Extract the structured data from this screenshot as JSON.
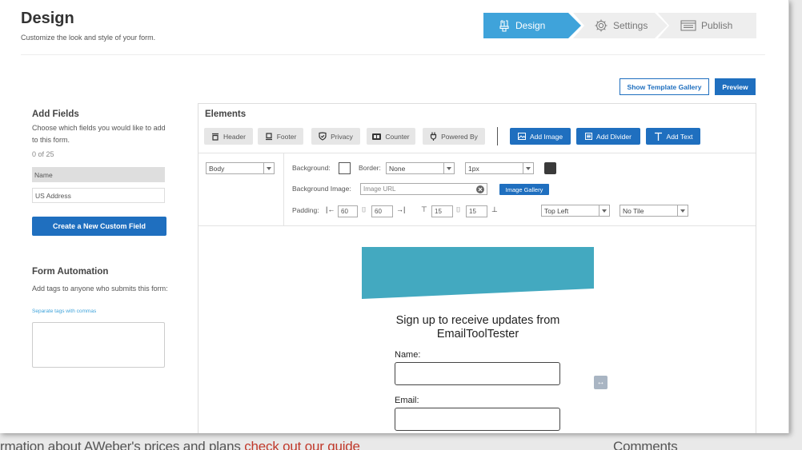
{
  "background_page": {
    "text_left": "rmation about AWeber's prices and plans",
    "text_link": "check out our guide",
    "text_right": "Comments"
  },
  "header": {
    "title": "Design",
    "subtitle": "Customize the look and style of your form.",
    "steps": [
      {
        "label": "Design",
        "icon": "brush-icon",
        "active": true
      },
      {
        "label": "Settings",
        "icon": "gear-icon",
        "active": false
      },
      {
        "label": "Publish",
        "icon": "browser-icon",
        "active": false
      }
    ]
  },
  "actions": {
    "template_gallery": "Show Template Gallery",
    "preview": "Preview"
  },
  "add_fields": {
    "heading": "Add Fields",
    "description": "Choose which fields you would like to add to this form.",
    "count": "0 of 25",
    "fields": [
      "Name",
      "US Address"
    ],
    "create_button": "Create a New Custom Field"
  },
  "automation": {
    "heading": "Form Automation",
    "description": "Add tags to anyone who submits this form:",
    "hint": "Separate tags with commas",
    "tags_value": ""
  },
  "elements": {
    "heading": "Elements",
    "toggles": [
      {
        "label": "Header",
        "icon": "header-icon"
      },
      {
        "label": "Footer",
        "icon": "footer-icon"
      },
      {
        "label": "Privacy",
        "icon": "shield-icon"
      },
      {
        "label": "Counter",
        "icon": "counter-icon"
      },
      {
        "label": "Powered By",
        "icon": "plug-icon"
      }
    ],
    "add_buttons": [
      {
        "label": "Add Image",
        "icon": "image-icon"
      },
      {
        "label": "Add Divider",
        "icon": "divider-icon"
      },
      {
        "label": "Add Text",
        "icon": "text-icon"
      }
    ]
  },
  "toolbar": {
    "section_select": "Body",
    "background_label": "Background:",
    "border_label": "Border:",
    "border_style": "None",
    "border_width": "1px",
    "border_color": "#3a3a3a",
    "background_color": "#ffffff",
    "bg_image_label": "Background Image:",
    "bg_image_placeholder": "Image URL",
    "image_gallery": "Image Gallery",
    "padding_label": "Padding:",
    "padding_left": "60",
    "padding_right": "60",
    "padding_top": "15",
    "padding_bottom": "15",
    "position": "Top Left",
    "tile": "No Tile"
  },
  "form_preview": {
    "banner_color": "#43a9c0",
    "title": "Sign up to receive updates from EmailToolTester",
    "fields": [
      {
        "label": "Name:",
        "value": ""
      },
      {
        "label": "Email:",
        "value": ""
      }
    ]
  },
  "colors": {
    "accent": "#3fa3da",
    "primary": "#1f6fbf"
  }
}
